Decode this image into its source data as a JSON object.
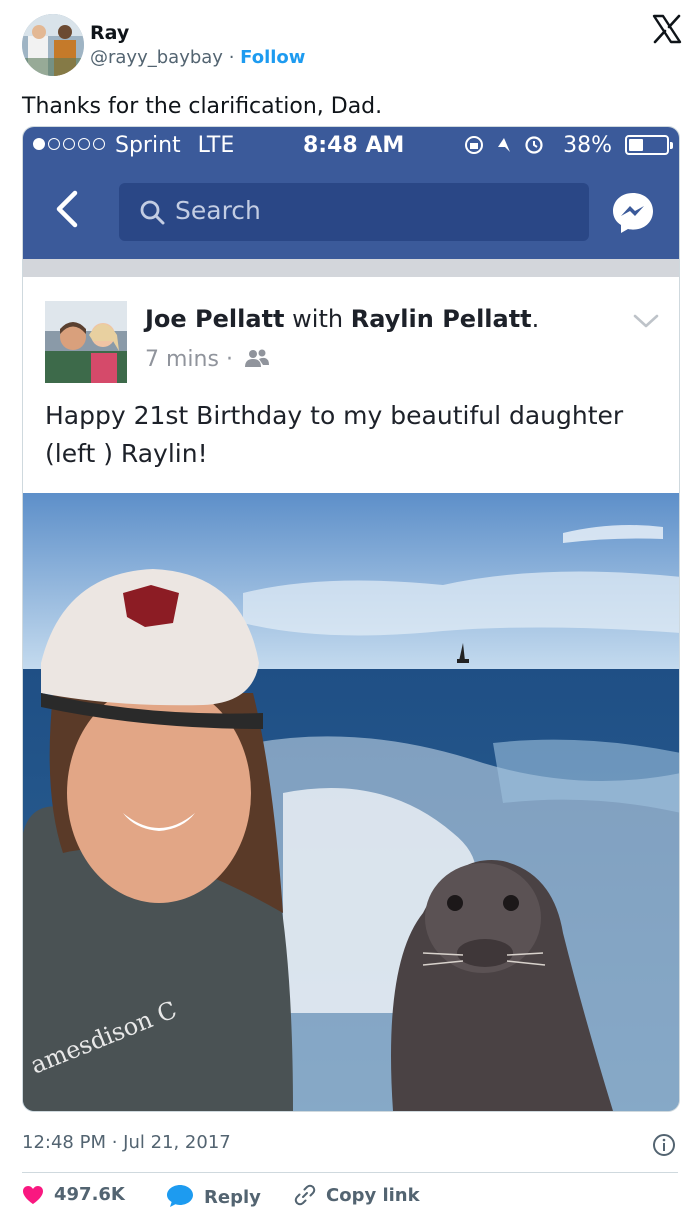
{
  "tweet": {
    "author_name": "Ray",
    "handle": "@rayy_baybay",
    "separator": "·",
    "follow_label": "Follow",
    "text": "Thanks for the clarification, Dad.",
    "timestamp": "12:48 PM · Jul 21, 2017"
  },
  "embedded_screenshot": {
    "status_bar": {
      "carrier": "Sprint",
      "network": "LTE",
      "time": "8:48 AM",
      "battery": "38%",
      "battery_level": 0.38,
      "signal_bars_filled": 1,
      "signal_bars_total": 5
    },
    "search": {
      "placeholder": "Search"
    },
    "post": {
      "author": "Joe Pellatt",
      "with_word": "with",
      "tagged": "Raylin Pellatt",
      "tagged_suffix": ".",
      "time_ago": "7 mins",
      "meta_separator": "·",
      "text": "Happy 21st Birthday to my beautiful daughter (left ) Raylin!",
      "photo_shirt_text": "amesdison C"
    }
  },
  "actions": {
    "likes": "497.6K",
    "reply_label": "Reply",
    "copy_label": "Copy link"
  },
  "colors": {
    "facebook_blue": "#3b5a9a",
    "twitter_blue": "#1d9bf0",
    "like_pink": "#f91880"
  }
}
